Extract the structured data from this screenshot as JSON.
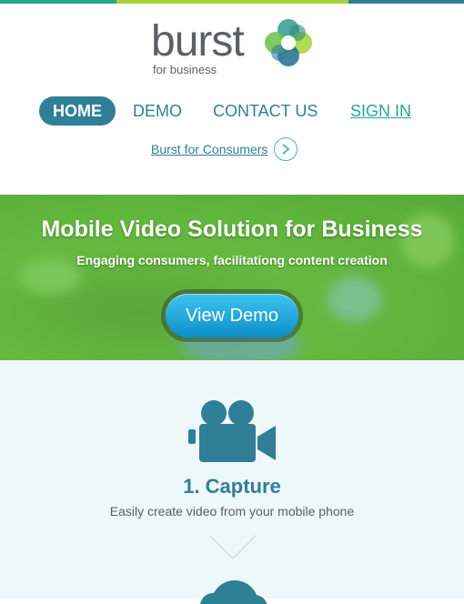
{
  "topbar": {
    "colors": [
      "#27a88a",
      "#a6d23b",
      "#a6d23b",
      "#2f7f97"
    ]
  },
  "logo": {
    "word": "burst",
    "sub": "for business",
    "mark_icon": "burst-flower-logo"
  },
  "nav": {
    "items": [
      {
        "label": "HOME",
        "active": true
      },
      {
        "label": "DEMO",
        "active": false
      },
      {
        "label": "CONTACT US",
        "active": false
      },
      {
        "label": "SIGN IN",
        "active": false
      }
    ],
    "consumer_link": "Burst for Consumers",
    "consumer_icon": "chevron-right-icon"
  },
  "hero": {
    "title": "Mobile Video Solution for Business",
    "subtitle": "Engaging consumers, facilitationg content creation",
    "button": "View Demo"
  },
  "features": {
    "items": [
      {
        "icon": "video-camera-icon",
        "title": "1. Capture",
        "description": "Easily create video from your mobile phone"
      }
    ],
    "next_icon": "chevron-down-icon",
    "cloud_icon": "cloud-icon"
  },
  "colors": {
    "primary": "#2f7f97",
    "signin": "#27a88a",
    "hero_green": "#66b93f",
    "button_blue": "#1ea6dc",
    "section_bg": "#eef7f9"
  }
}
